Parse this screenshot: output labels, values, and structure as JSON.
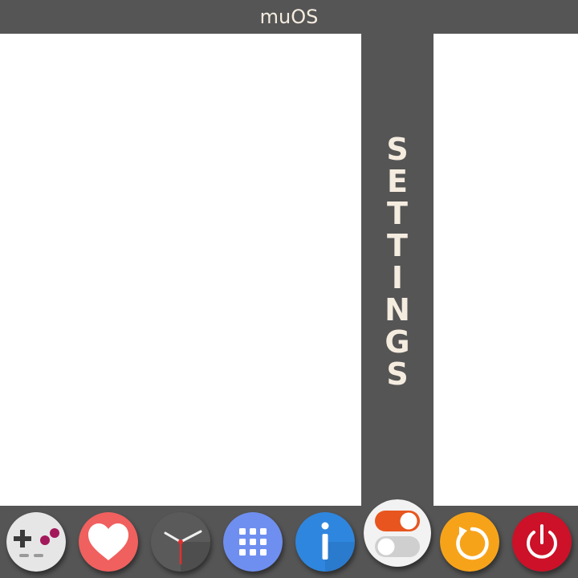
{
  "header": {
    "title": "muOS"
  },
  "section": {
    "title_letters": [
      "S",
      "E",
      "T",
      "T",
      "I",
      "N",
      "G",
      "S"
    ]
  },
  "dock": {
    "selected": "settings",
    "items": [
      {
        "id": "explore",
        "icon": "gamepad-icon",
        "color": "#e6e6e6"
      },
      {
        "id": "favourites",
        "icon": "heart-icon",
        "color": "#f0605e"
      },
      {
        "id": "history",
        "icon": "clock-icon",
        "color": "#5a5a5a"
      },
      {
        "id": "applications",
        "icon": "grid-icon",
        "color": "#6f8ff0"
      },
      {
        "id": "information",
        "icon": "info-icon",
        "color": "#2f86de"
      },
      {
        "id": "settings",
        "icon": "toggle-icon",
        "color": "#f2f2f2"
      },
      {
        "id": "reboot",
        "icon": "reboot-icon",
        "color": "#f7a31a"
      },
      {
        "id": "shutdown",
        "icon": "power-icon",
        "color": "#cc1128"
      }
    ]
  }
}
